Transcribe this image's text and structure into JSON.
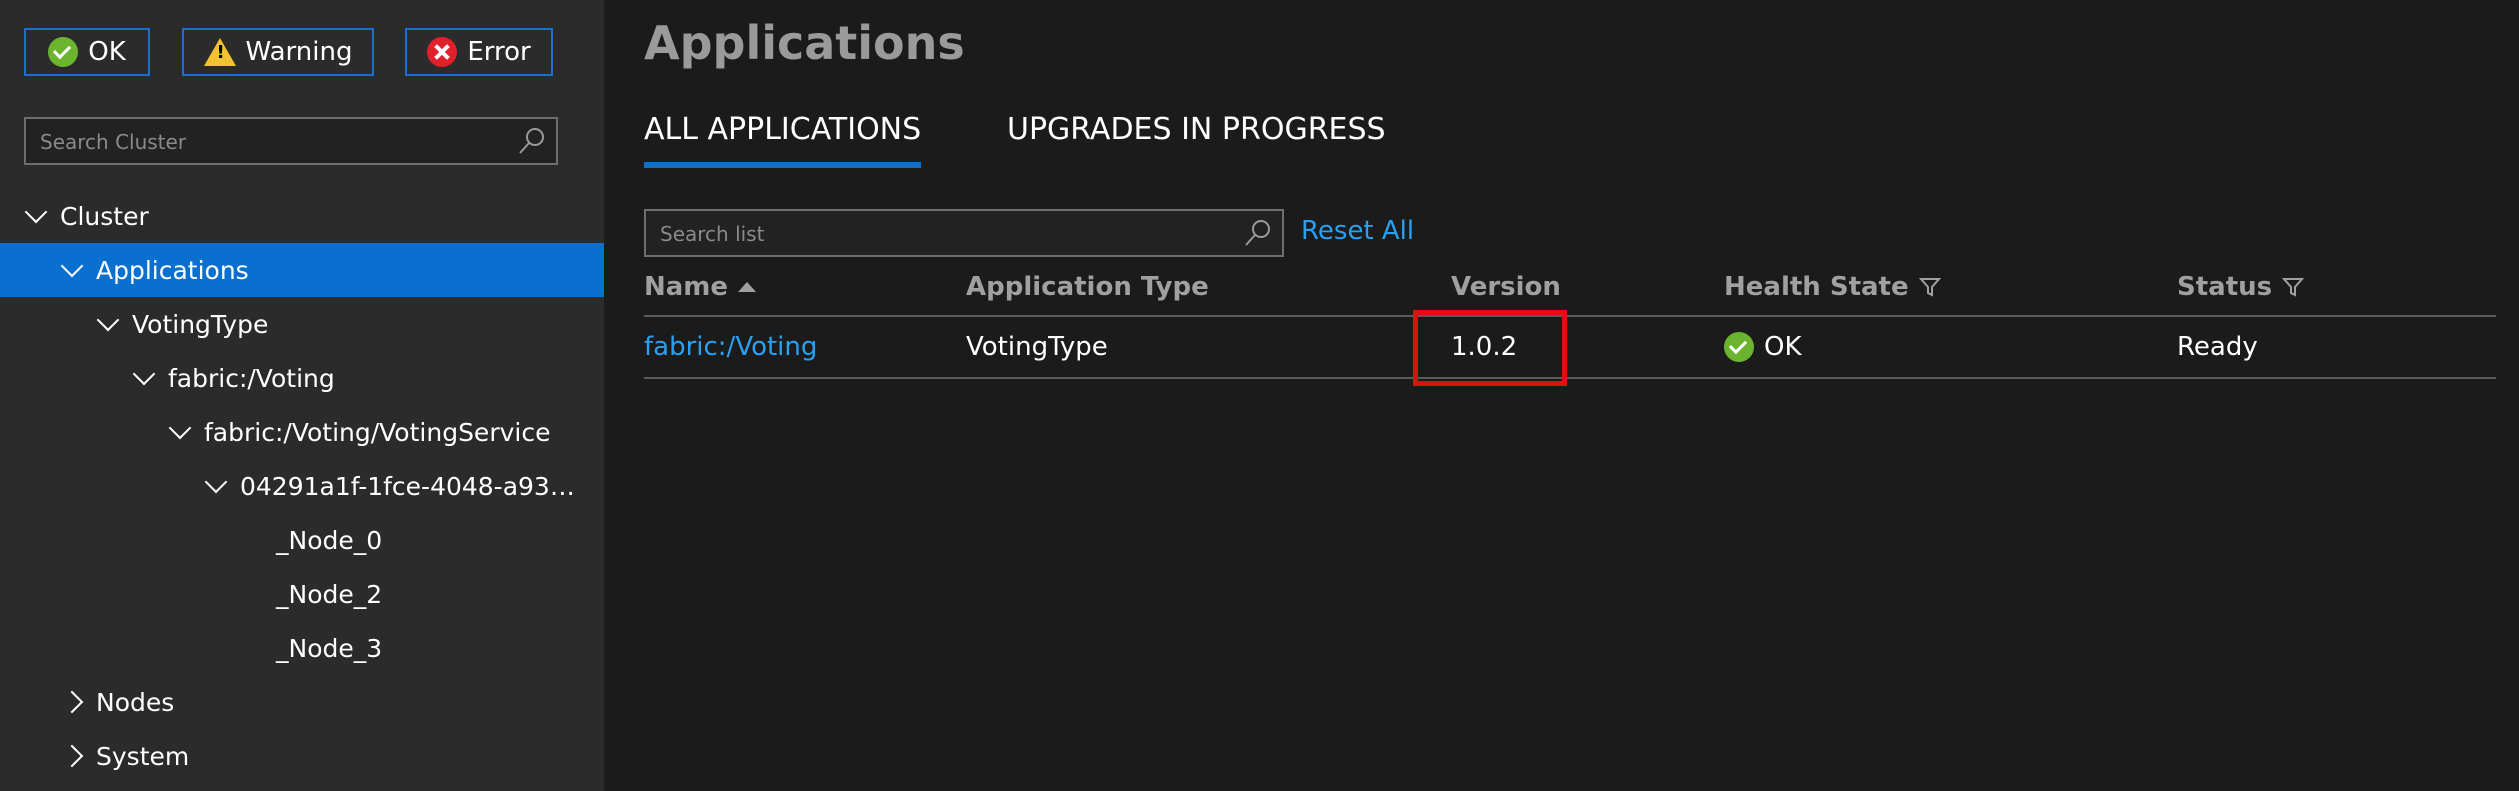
{
  "filters": {
    "ok": {
      "label": "OK",
      "icon": "ok-check-icon"
    },
    "warning": {
      "label": "Warning",
      "icon": "warning-triangle-icon"
    },
    "error": {
      "label": "Error",
      "icon": "error-x-icon"
    }
  },
  "sidebar": {
    "search_placeholder": "Search Cluster",
    "tree": [
      {
        "label": "Cluster",
        "expanded": true,
        "selected": false
      },
      {
        "label": "Applications",
        "expanded": true,
        "selected": true
      },
      {
        "label": "VotingType",
        "expanded": true,
        "selected": false
      },
      {
        "label": "fabric:/Voting",
        "expanded": true,
        "selected": false
      },
      {
        "label": "fabric:/Voting/VotingService",
        "expanded": true,
        "selected": false
      },
      {
        "label": "04291a1f-1fce-4048-a93…",
        "expanded": true,
        "selected": false
      },
      {
        "label": "_Node_0",
        "expanded": null,
        "selected": false
      },
      {
        "label": "_Node_2",
        "expanded": null,
        "selected": false
      },
      {
        "label": "_Node_3",
        "expanded": null,
        "selected": false
      },
      {
        "label": "Nodes",
        "expanded": false,
        "selected": false
      },
      {
        "label": "System",
        "expanded": false,
        "selected": false
      }
    ]
  },
  "main": {
    "title": "Applications",
    "tabs": [
      {
        "label": "ALL APPLICATIONS",
        "active": true
      },
      {
        "label": "UPGRADES IN PROGRESS",
        "active": false
      }
    ],
    "search_placeholder": "Search list",
    "reset_label": "Reset All",
    "columns": [
      {
        "label": "Name",
        "sort": "asc",
        "filter": false
      },
      {
        "label": "Application Type",
        "sort": null,
        "filter": false
      },
      {
        "label": "Version",
        "sort": null,
        "filter": false
      },
      {
        "label": "Health State",
        "sort": null,
        "filter": true
      },
      {
        "label": "Status",
        "sort": null,
        "filter": true
      }
    ],
    "rows": [
      {
        "name": "fabric:/Voting",
        "type": "VotingType",
        "version": "1.0.2",
        "health": "OK",
        "status": "Ready"
      }
    ]
  },
  "colors": {
    "accent": "#0a70d0",
    "link": "#2aa0f0",
    "ok": "#6bb42f",
    "error": "#e0202b",
    "warning": "#f2c230",
    "highlight": "#e01010"
  }
}
